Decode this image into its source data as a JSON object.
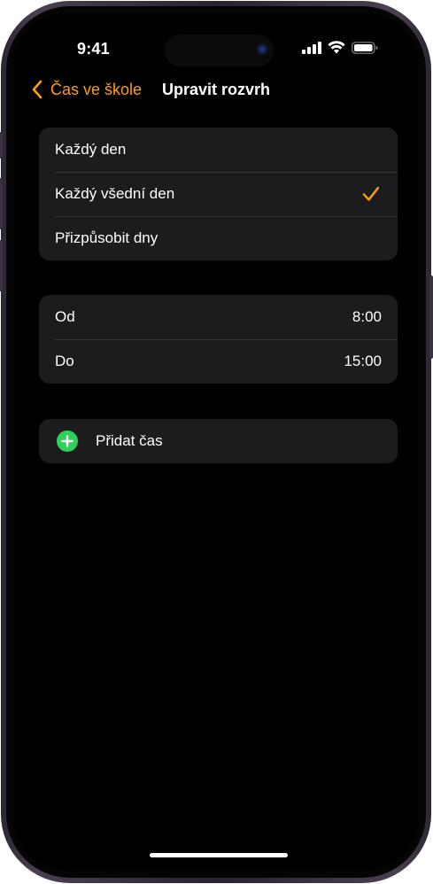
{
  "status_bar": {
    "time": "9:41"
  },
  "nav": {
    "back_label": "Čas ve škole",
    "title": "Upravit rozvrh"
  },
  "days": {
    "items": [
      {
        "label": "Každý den",
        "selected": false
      },
      {
        "label": "Každý všední den",
        "selected": true
      },
      {
        "label": "Přizpůsobit dny",
        "selected": false
      }
    ]
  },
  "times": {
    "from_label": "Od",
    "from_value": "8:00",
    "to_label": "Do",
    "to_value": "15:00"
  },
  "add": {
    "label": "Přidat čas"
  },
  "colors": {
    "accent": "#ff9f0a",
    "add_green": "#30d158",
    "cell_background": "#1c1c1e",
    "screen_background": "#000000"
  }
}
